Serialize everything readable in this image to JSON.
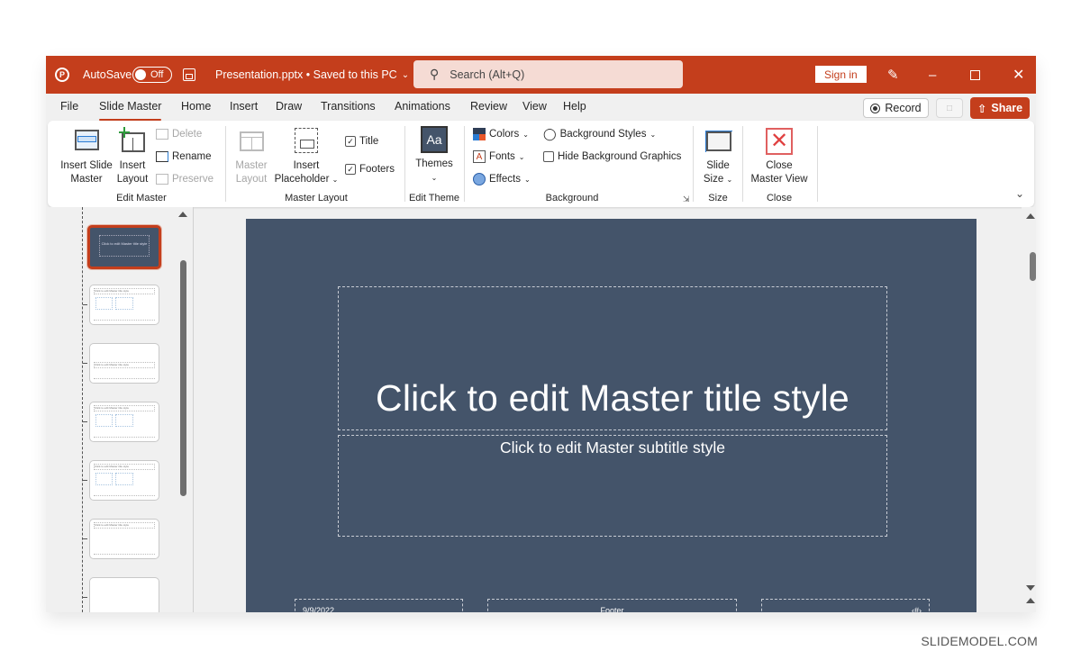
{
  "titlebar": {
    "app_icon": "powerpoint-logo",
    "autosave_label": "AutoSave",
    "autosave_state": "Off",
    "document_title": "Presentation.pptx • Saved to this PC",
    "search_placeholder": "Search (Alt+Q)",
    "sign_in_label": "Sign in",
    "window_controls": [
      "minimize",
      "maximize",
      "close"
    ],
    "accent_color": "#c43e1c"
  },
  "tabs": {
    "items": [
      {
        "label": "File"
      },
      {
        "label": "Slide Master",
        "active": true
      },
      {
        "label": "Home"
      },
      {
        "label": "Insert"
      },
      {
        "label": "Draw"
      },
      {
        "label": "Transitions"
      },
      {
        "label": "Animations"
      },
      {
        "label": "Review"
      },
      {
        "label": "View"
      },
      {
        "label": "Help"
      }
    ],
    "record_label": "Record",
    "share_label": "Share"
  },
  "ribbon": {
    "edit_master": {
      "label": "Edit Master",
      "insert_slide_master": "Insert Slide\nMaster",
      "insert_slide_master_l1": "Insert Slide",
      "insert_slide_master_l2": "Master",
      "insert_layout_l1": "Insert",
      "insert_layout_l2": "Layout",
      "delete": "Delete",
      "rename": "Rename",
      "preserve": "Preserve"
    },
    "master_layout": {
      "label": "Master Layout",
      "master_layout_l1": "Master",
      "master_layout_l2": "Layout",
      "insert_placeholder_l1": "Insert",
      "insert_placeholder_l2": "Placeholder",
      "title_checkbox": "Title",
      "title_checked": true,
      "footers_checkbox": "Footers",
      "footers_checked": true
    },
    "edit_theme": {
      "label": "Edit Theme",
      "themes": "Themes",
      "themes_icon_text": "Aa"
    },
    "background": {
      "label": "Background",
      "colors": "Colors",
      "fonts": "Fonts",
      "effects": "Effects",
      "background_styles": "Background Styles",
      "hide_background_graphics": "Hide Background Graphics",
      "hide_checked": false
    },
    "size": {
      "label": "Size",
      "slide_size_l1": "Slide",
      "slide_size_l2": "Size"
    },
    "close": {
      "label": "Close",
      "close_master_view_l1": "Close",
      "close_master_view_l2": "Master View"
    }
  },
  "thumbnails": [
    {
      "type": "master",
      "selected": true,
      "caption": "Click to edit Master title style"
    },
    {
      "type": "title-and-content",
      "caption": "Click to edit Master title style"
    },
    {
      "type": "section-header",
      "caption": "Click to edit Master title style"
    },
    {
      "type": "two-content",
      "caption": "Click to edit Master title style"
    },
    {
      "type": "comparison",
      "caption": "Click to edit Master title style"
    },
    {
      "type": "title-only",
      "caption": "Click to edit Master title style"
    },
    {
      "type": "blank",
      "caption": ""
    }
  ],
  "slide": {
    "background_color": "#44546a",
    "title": "Click to edit Master title style",
    "subtitle": "Click to edit Master subtitle style",
    "date": "9/9/2022",
    "footer": "Footer",
    "slide_number": "‹#›"
  },
  "watermark": "SLIDEMODEL.COM"
}
